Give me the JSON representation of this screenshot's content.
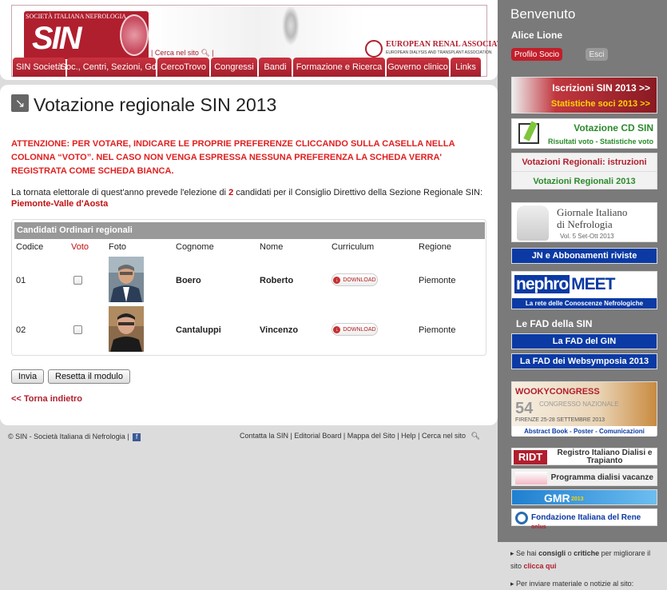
{
  "header": {
    "logo_top": "SOCIETÀ ITALIANA NEFROLOGIA",
    "logo_big": "SIN",
    "search_link": "| Cerca nel sito",
    "era_title": "EUROPEAN RENAL ASSOCIATION",
    "era_sub": "EUROPEAN DIALYSIS AND TRANSPLANT ASSOCIATION"
  },
  "nav": [
    "SIN Società",
    "Soc., Centri, Sezioni, GdS",
    "CercoTrovo",
    "Congressi",
    "Bandi",
    "Formazione e Ricerca",
    "Governo clinico",
    "Links"
  ],
  "page": {
    "title": "Votazione regionale SIN 2013",
    "warning": "ATTENZIONE: PER VOTARE, INDICARE LE PROPRIE PREFERENZE CLICCANDO SULLA CASELLA NELLA COLONNA “VOTO”. NEL CASO NON VENGA ESPRESSA NESSUNA PREFERENZA LA SCHEDA VERRA' REGISTRATA COME SCHEDA BIANCA.",
    "intro_before": "La tornata elettorale di quest'anno prevede l'elezione di ",
    "intro_num": "2",
    "intro_after": " candidati per il Consiglio Direttivo della Sezione Regionale SIN:",
    "region": "Piemonte-Valle d'Aosta"
  },
  "table": {
    "title": "Candidati Ordinari regionali",
    "headers": {
      "codice": "Codice",
      "voto": "Voto",
      "foto": "Foto",
      "cognome": "Cognome",
      "nome": "Nome",
      "curriculum": "Curriculum",
      "regione": "Regione"
    },
    "rows": [
      {
        "codice": "01",
        "cognome": "Boero",
        "nome": "Roberto",
        "download": "DOWNLOAD",
        "regione": "Piemonte"
      },
      {
        "codice": "02",
        "cognome": "Cantaluppi",
        "nome": "Vincenzo",
        "download": "DOWNLOAD",
        "regione": "Piemonte"
      }
    ]
  },
  "buttons": {
    "invia": "Invia",
    "reset": "Resetta il modulo"
  },
  "back_link": "<< Torna indietro",
  "footer": {
    "copyright": "© SIN - Società Italiana di Nefrologia |",
    "links": "Contatta la SIN | Editorial Board | Mappa del Sito | Help | Cerca nel sito"
  },
  "sidebar": {
    "welcome": "Benvenuto",
    "user": "Alice Lione",
    "profile": "Profilo Socio",
    "logout": "Esci",
    "iscrizioni": "Iscrizioni SIN 2013 >>",
    "statistiche": "Statistiche soci 2013 >>",
    "votazione_cd": "Votazione CD SIN",
    "votazione_cd_sub": "Risultati voto - Statistiche voto",
    "vot_reg_istr": "Votazioni Regionali: istruzioni",
    "vot_reg": "Votazioni Regionali 2013",
    "gin_l1": "Giornale Italiano",
    "gin_l2": "di Nefrologia",
    "gin_l3": "Vol. 5 Set-Ott 2013",
    "jn": "JN e Abbonamenti riviste",
    "nephro_a": "nephro",
    "nephro_b": "MEET",
    "nephro_sub": "La rete delle Conoscenze Nefrologiche",
    "fad_title": "Le FAD della SIN",
    "fad1": "La FAD del GIN",
    "fad2": "La FAD dei Websymposia 2013",
    "wooky_title": "WOOKYCONGRESS",
    "wooky_num": "54",
    "wooky_cong": "CONGRESSO NAZIONALE",
    "wooky_city": "FIRENZE 25-28 SETTEMBRE 2013",
    "wooky_sub": "Abstract Book - Poster - Comunicazioni",
    "ridt_logo": "RIDT",
    "ridt_text": "Registro Italiano Dialisi e Trapianto",
    "prog": "Programma dialisi vacanze",
    "gmr": "GMR",
    "gmr_year": "2013",
    "fond": "Fondazione Italiana del Rene",
    "fond_tag": "onlus",
    "note1_a": "Se hai ",
    "note1_b": "consigli",
    "note1_c": " o ",
    "note1_d": "critiche",
    "note1_e": " per migliorare il sito ",
    "note1_f": "clicca qui",
    "note2": "Per inviare materiale o notizie al sito:"
  }
}
